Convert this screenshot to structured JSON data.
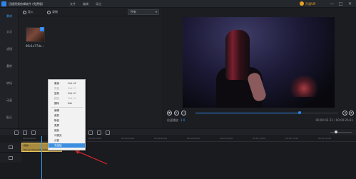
{
  "titlebar": {
    "app_title": "迅捷视频剪辑软件 (免费版)",
    "menus": [
      "文件",
      "编辑",
      "导出"
    ],
    "vip_label": "开通VIP",
    "window_buttons": [
      "—",
      "□",
      "✕"
    ]
  },
  "sidebar": {
    "items": [
      "素材",
      "文字",
      "滤镜",
      "叠附",
      "转场",
      "动画",
      "配乐"
    ],
    "active_index": 0
  },
  "media": {
    "import_label": "导入",
    "record_label": "录制",
    "filter_value": "所有",
    "thumbnail_name": "89c1e77de..."
  },
  "preview": {
    "speed_label": "倍速播放",
    "speed_value": "1.0",
    "timecode": "00:00:02.22 / 00:00:26.61",
    "seek_progress": 0.73
  },
  "timeline": {
    "ruler_ticks": [
      "00:00:00.00",
      "00:00:10.00",
      "00:00:20.00",
      "00:00:30.00",
      "00:00:40.00",
      "00:00:50.00",
      "00:01:00.00",
      "00:01:10.00",
      "00:01:20.00",
      "00:01:30.00"
    ],
    "clip_name": "视频1",
    "clip_file": "89c1e77deddc63a350d..."
  },
  "context_menu": {
    "items": [
      {
        "label": "撤销",
        "shortcut": "Ctrl+Z",
        "disabled": false
      },
      {
        "label": "恢复",
        "shortcut": "Ctrl+Y",
        "disabled": true
      },
      {
        "label": "复制",
        "shortcut": "Ctrl+C",
        "disabled": false
      },
      {
        "label": "粘贴",
        "shortcut": "Ctrl+V",
        "disabled": true
      },
      {
        "label": "删除",
        "shortcut": "Del",
        "disabled": false
      },
      {
        "label": "编辑",
        "shortcut": "",
        "disabled": false
      },
      {
        "label": "裁剪",
        "shortcut": "",
        "disabled": false
      },
      {
        "label": "静音",
        "shortcut": "",
        "disabled": false
      },
      {
        "label": "黑屏",
        "shortcut": "",
        "disabled": false
      },
      {
        "label": "倒放",
        "shortcut": "",
        "disabled": false
      },
      {
        "label": "马赛克",
        "shortcut": "",
        "disabled": false
      },
      {
        "label": "分割",
        "shortcut": "",
        "disabled": false
      },
      {
        "label": "冻结帧",
        "shortcut": "",
        "disabled": false
      }
    ],
    "highlighted_index": 12
  },
  "colors": {
    "accent": "#2f86ea",
    "clip": "#a88b3e",
    "annotation_arrow": "#e0262b"
  }
}
